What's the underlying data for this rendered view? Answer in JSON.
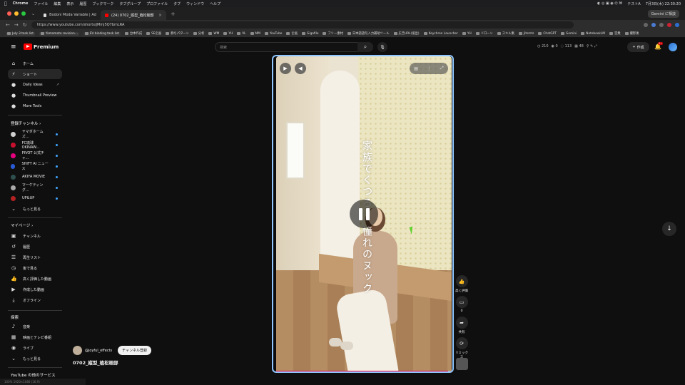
{
  "menubar": {
    "app": "Chrome",
    "items": [
      "ファイル",
      "編集",
      "表示",
      "履歴",
      "ブックマーク",
      "タブグループ",
      "プロファイル",
      "タブ",
      "ウィンドウ",
      "ヘルプ"
    ],
    "clock": "7月3日(木) 22:30:20",
    "user": "テストA"
  },
  "tabs": [
    {
      "title": "Bodoni Moda Variable | Adobe..."
    },
    {
      "title": "(24) 0702_縦型_植松梱部"
    }
  ],
  "gemini_button": "Gemini に相談",
  "address": {
    "url": "https://www.youtube.com/shorts/jMmj5Q7bmLRA"
  },
  "bookmarks": [
    "July 3 task list",
    "Yamamoto revision...",
    "EV binding task list",
    "台本作成",
    "SE企画",
    "静ちパターン",
    "分析",
    "WM",
    "YH",
    "VL",
    "MM",
    "YouTube",
    "企画",
    "Gigafile",
    "フリー素材",
    "日本語語句入力補助ツール",
    "広告URL(協出)",
    "Keychron Launcher",
    "YH",
    "ドローン",
    "スキル集",
    "Jitsmts",
    "ChatGPT",
    "Gemini",
    "NotebookLM",
    "営業",
    "撮影後"
  ],
  "header": {
    "logo": "Premium",
    "search_placeholder": "検索",
    "stats": [
      "210",
      "0",
      "113",
      "48"
    ],
    "create": "作成",
    "notif_count": "9+"
  },
  "sidebar": {
    "main": [
      {
        "label": "ホーム",
        "icon": "home-icon"
      },
      {
        "label": "ショート",
        "icon": "shorts-icon"
      },
      {
        "label": "Daily Ideas",
        "icon": "extension-icon"
      },
      {
        "label": "Thumbnail Preview",
        "icon": "extension-icon"
      },
      {
        "label": "More Tools",
        "icon": "extension-icon"
      }
    ],
    "subscriptions_header": "登録チャンネル",
    "subscriptions": [
      {
        "label": "ヤマダホームズ...",
        "color": "#d0d0d0"
      },
      {
        "label": "FC琉球OKINAW...",
        "color": "#c8102e"
      },
      {
        "label": "PIVOT 公式チャ...",
        "color": "#e6007e"
      },
      {
        "label": "SHIFT AI ニュース",
        "color": "#2a5bd7"
      },
      {
        "label": "AKIYA MOVIE",
        "color": "#2f4f4f"
      },
      {
        "label": "マーケティング...",
        "color": "#aaaaaa"
      },
      {
        "label": "UP&UP",
        "color": "#b22222"
      }
    ],
    "show_more": "もっと見る",
    "you_header": "マイページ",
    "you": [
      {
        "label": "チャンネル",
        "icon": "channel-icon"
      },
      {
        "label": "履歴",
        "icon": "history-icon"
      },
      {
        "label": "再生リスト",
        "icon": "playlist-icon"
      },
      {
        "label": "後で見る",
        "icon": "clock-icon"
      },
      {
        "label": "高く評価した動画",
        "icon": "thumb-up-icon"
      },
      {
        "label": "作成した動画",
        "icon": "video-icon"
      },
      {
        "label": "オフライン",
        "icon": "download-icon"
      }
    ],
    "explore_header": "探索",
    "explore": [
      {
        "label": "音楽",
        "icon": "music-icon"
      },
      {
        "label": "映画とテレビ番組",
        "icon": "film-icon"
      },
      {
        "label": "ライブ",
        "icon": "live-icon"
      }
    ],
    "show_more2": "もっと見る",
    "more_services": "YouTube の他のサービス"
  },
  "short": {
    "overlay_text_right": "家族でくつろ",
    "overlay_text_center": "憧れのヌック",
    "channel": "@joyful_effects",
    "subscribe": "チャンネル登録",
    "title": "0702_縦型_植松梱部",
    "progress": 0.98
  },
  "actions": {
    "like_label": "高く評価",
    "comment_count": "0",
    "share_label": "共有",
    "remix_label": "リミックス"
  },
  "statusbar": "100%   1920×1080 (16:9)"
}
